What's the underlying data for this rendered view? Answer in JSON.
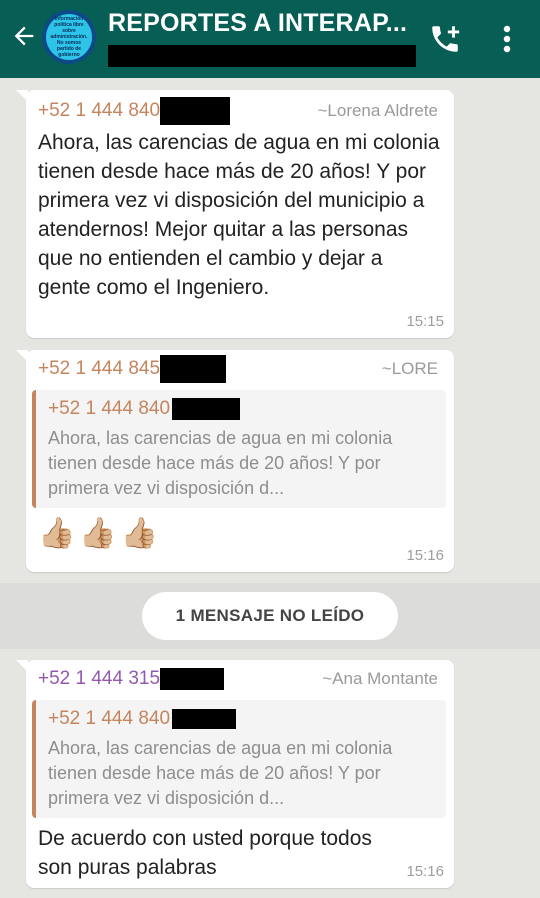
{
  "header": {
    "title": "REPORTES A INTERAP...",
    "avatar_text": "Información política libre sobre administración. No somos partido de gobierno"
  },
  "messages": [
    {
      "sender": "+52 1 444 840",
      "alias": "~Lorena Aldrete",
      "text": "Ahora, las carencias de agua en mi colonia tienen desde hace más de 20 años! Y por primera vez vi disposición del municipio a atendernos! Mejor quitar a las personas que no entienden el cambio y dejar a gente como el Ingeniero.",
      "time": "15:15"
    },
    {
      "sender": "+52 1 444 845",
      "alias": "~LORE",
      "quote_sender": "+52 1 444 840",
      "quote_text": "Ahora, las carencias de agua en mi colonia tienen desde hace más de 20 años! Y por primera vez vi disposición d...",
      "text": "👍🏼👍🏼👍🏼",
      "time": "15:16"
    },
    {
      "sender": "+52 1 444 315",
      "alias": "~Ana Montante",
      "quote_sender": "+52 1 444 840",
      "quote_text": "Ahora, las carencias de agua en mi colonia tienen desde hace más de 20 años! Y por primera vez vi disposición d...",
      "text": "De acuerdo con usted porque todos son puras palabras",
      "time": "15:16"
    }
  ],
  "unread_label": "1 MENSAJE NO LEÍDO",
  "colors": {
    "header": "#075e54",
    "sender_orange": "#c5845c",
    "sender_purple": "#9359b0"
  },
  "icons": [
    "back-arrow-icon",
    "add-call-icon",
    "more-vert-icon"
  ]
}
